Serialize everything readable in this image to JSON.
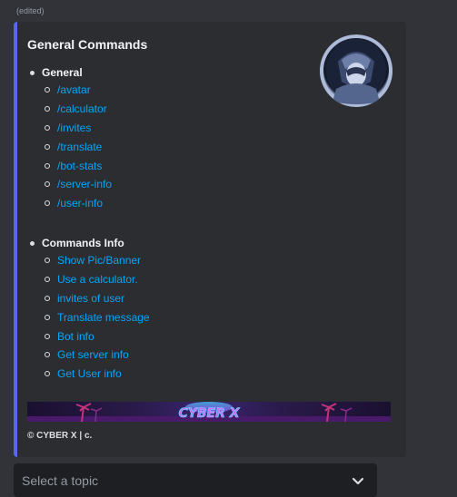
{
  "message": {
    "edited_label": "(edited)"
  },
  "embed": {
    "accent_color": "#5865f2",
    "title": "General Commands",
    "sections": [
      {
        "heading": "General",
        "items": [
          "/avatar",
          "/calculator",
          "/invites",
          "/translate",
          "/bot-stats",
          "/server-info",
          "/user-info"
        ]
      },
      {
        "heading": "Commands Info",
        "items": [
          "Show Pic/Banner",
          "Use a calculator.",
          "invites of user",
          "Translate message",
          "Bot info",
          "Get server info",
          "Get User info"
        ]
      }
    ],
    "banner_text": "CYBER X",
    "footer": "© CYBER X | c."
  },
  "select_menu": {
    "placeholder": "Select a topic",
    "icon": "chevron-down-icon"
  }
}
